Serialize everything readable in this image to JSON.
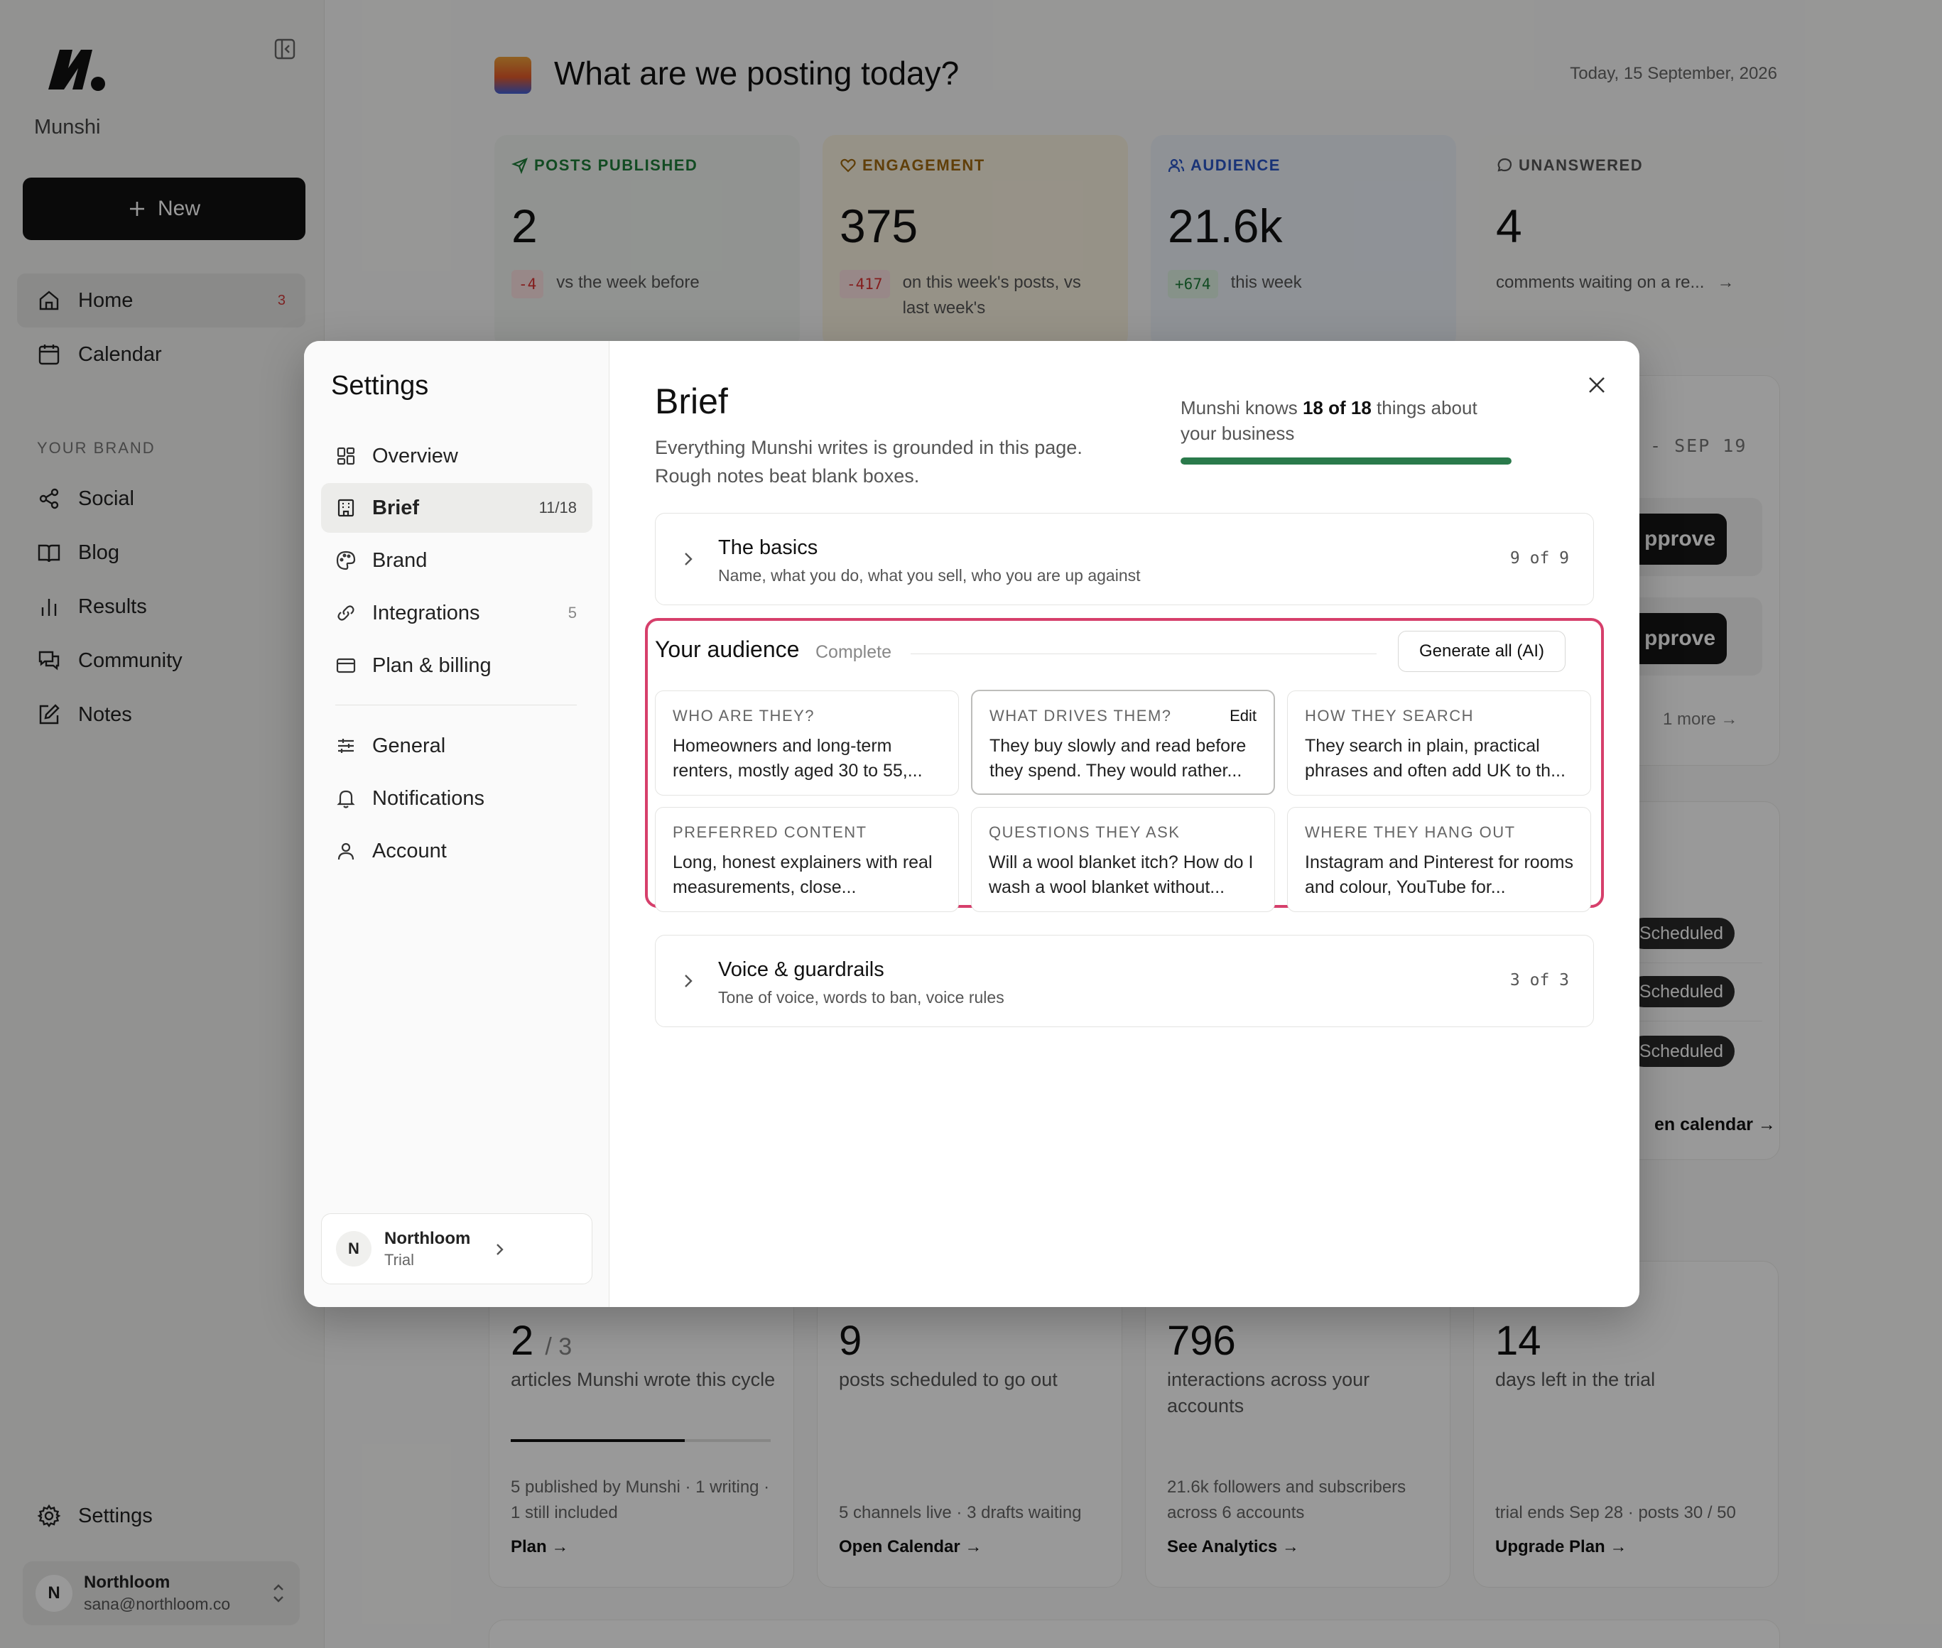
{
  "app": {
    "brand_name": "Munshi",
    "new_label": "New",
    "nav": [
      {
        "label": "Home",
        "icon": "home-icon",
        "count": "3",
        "active": true
      },
      {
        "label": "Calendar",
        "icon": "calendar-icon"
      }
    ],
    "section_label": "YOUR BRAND",
    "brand_nav": [
      {
        "label": "Social",
        "icon": "share-icon"
      },
      {
        "label": "Blog",
        "icon": "book-icon"
      },
      {
        "label": "Results",
        "icon": "bar-chart-icon"
      },
      {
        "label": "Community",
        "icon": "chat-icon"
      },
      {
        "label": "Notes",
        "icon": "edit-icon"
      }
    ],
    "settings_label": "Settings",
    "user": {
      "initial": "N",
      "name": "Northloom",
      "email": "sana@northloom.co"
    }
  },
  "home": {
    "title": "What are we posting today?",
    "date": "Today, 15 September, 2026",
    "stats": [
      {
        "label": "POSTS PUBLISHED",
        "value": "2",
        "delta": "-4",
        "note": "vs the week before",
        "color": "#1e7d3a"
      },
      {
        "label": "ENGAGEMENT",
        "value": "375",
        "delta": "-417",
        "note": "on this week's posts, vs last week's",
        "color": "#a06a10"
      },
      {
        "label": "AUDIENCE",
        "value": "21.6k",
        "delta": "+674",
        "note": "this week",
        "color": "#2a56c6"
      },
      {
        "label": "UNANSWERED",
        "value": "4",
        "note": "comments waiting on a re..."
      }
    ],
    "week_range": "- SEP 19",
    "approve_label": "pprove",
    "more_label": "1 more",
    "scheduled_label": "Scheduled",
    "calendar_link": "en calendar →",
    "bottom": [
      {
        "value": "2",
        "of": "/ 3",
        "desc": "articles Munshi wrote this cycle",
        "note": "5 published by Munshi · 1 writing · 1 still included",
        "link": "Plan →",
        "progress": 0.67
      },
      {
        "value": "9",
        "desc": "posts scheduled to go out",
        "note": "5 channels live · 3 drafts waiting",
        "link": "Open Calendar →"
      },
      {
        "value": "796",
        "desc": "interactions across your accounts",
        "note": "21.6k followers and subscribers across 6 accounts",
        "link": "See Analytics →"
      },
      {
        "value": "14",
        "desc": "days left in the trial",
        "note": "trial ends Sep 28 · posts 30 / 50",
        "link": "Upgrade Plan →"
      }
    ]
  },
  "settings": {
    "title": "Settings",
    "nav": [
      {
        "label": "Overview",
        "icon": "grid-icon"
      },
      {
        "label": "Brief",
        "icon": "building-icon",
        "count": "11/18",
        "active": true
      },
      {
        "label": "Brand",
        "icon": "palette-icon"
      },
      {
        "label": "Integrations",
        "icon": "link-icon",
        "count": "5"
      },
      {
        "label": "Plan & billing",
        "icon": "credit-card-icon"
      }
    ],
    "nav2": [
      {
        "label": "General",
        "icon": "sliders-icon"
      },
      {
        "label": "Notifications",
        "icon": "bell-icon"
      },
      {
        "label": "Account",
        "icon": "user-icon"
      }
    ],
    "workspace": {
      "initial": "N",
      "name": "Northloom",
      "plan": "Trial"
    }
  },
  "brief": {
    "title": "Brief",
    "subtitle": "Everything Munshi writes is grounded in this page. Rough notes beat blank boxes.",
    "progress_prefix": "Munshi knows ",
    "progress_count": "18 of 18",
    "progress_suffix": " things about your business",
    "progress": 1.0,
    "basics": {
      "title": "The basics",
      "desc": "Name, what you do, what you sell, who you are up against",
      "count": "9 of 9"
    },
    "audience": {
      "title": "Your audience",
      "status": "Complete",
      "generate_label": "Generate all (AI)",
      "edit_label": "Edit",
      "fields": [
        {
          "label": "WHO ARE THEY?",
          "text": "Homeowners and long-term renters, mostly aged 30 to 55,..."
        },
        {
          "label": "WHAT DRIVES THEM?",
          "text": "They buy slowly and read before they spend. They would rather..."
        },
        {
          "label": "HOW THEY SEARCH",
          "text": "They search in plain, practical phrases and often add UK to th..."
        },
        {
          "label": "PREFERRED CONTENT",
          "text": "Long, honest explainers with real measurements, close..."
        },
        {
          "label": "QUESTIONS THEY ASK",
          "text": "Will a wool blanket itch? How do I wash a wool blanket without..."
        },
        {
          "label": "WHERE THEY HANG OUT",
          "text": "Instagram and Pinterest for rooms and colour, YouTube for..."
        }
      ]
    },
    "voice": {
      "title": "Voice & guardrails",
      "desc": "Tone of voice, words to ban, voice rules",
      "count": "3 of 3"
    }
  }
}
